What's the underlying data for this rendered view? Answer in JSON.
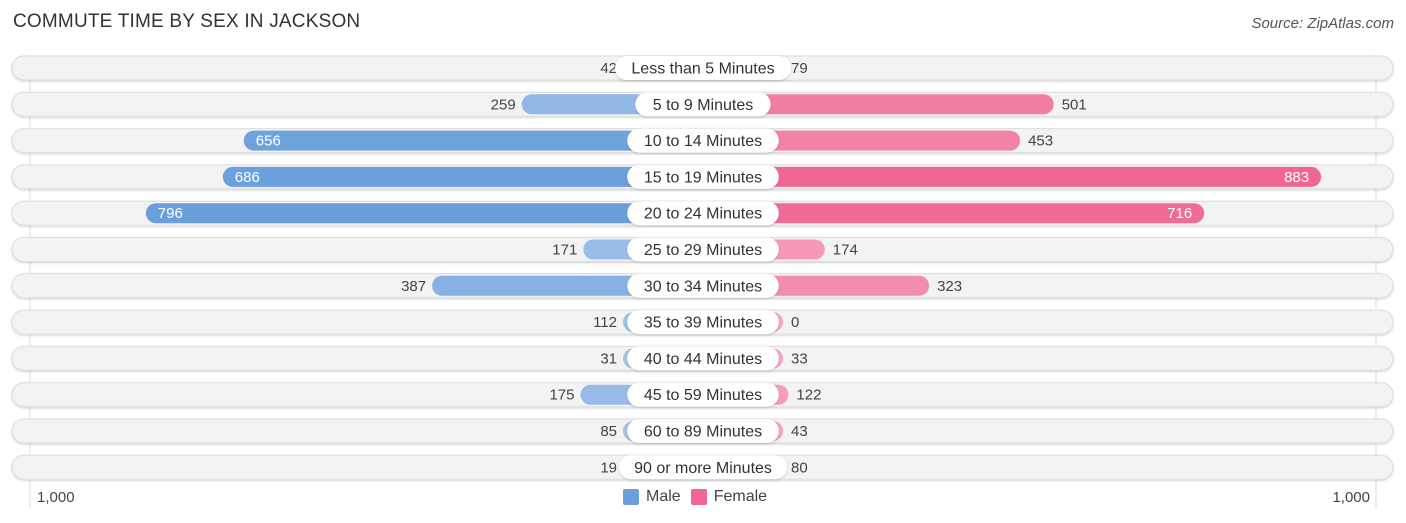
{
  "header": {
    "title": "COMMUTE TIME BY SEX IN JACKSON",
    "source": "Source: ZipAtlas.com"
  },
  "chart_data": {
    "type": "bar",
    "orientation": "horizontal-diverging",
    "title": "Commute Time by Sex in Jackson",
    "categories": [
      "Less than 5 Minutes",
      "5 to 9 Minutes",
      "10 to 14 Minutes",
      "15 to 19 Minutes",
      "20 to 24 Minutes",
      "25 to 29 Minutes",
      "30 to 34 Minutes",
      "35 to 39 Minutes",
      "40 to 44 Minutes",
      "45 to 59 Minutes",
      "60 to 89 Minutes",
      "90 or more Minutes"
    ],
    "series": [
      {
        "name": "Male",
        "color": "#6a9fdc",
        "values": [
          42,
          259,
          656,
          686,
          796,
          171,
          387,
          112,
          31,
          175,
          85,
          19
        ]
      },
      {
        "name": "Female",
        "color": "#f06892",
        "values": [
          79,
          501,
          453,
          883,
          716,
          174,
          323,
          0,
          33,
          122,
          43,
          80
        ]
      }
    ],
    "xlim": [
      -1000,
      1000
    ],
    "axis_labels": {
      "left": "1,000",
      "right": "1,000"
    },
    "legend": {
      "position": "bottom-center",
      "items": [
        "Male",
        "Female"
      ]
    },
    "colors": {
      "male_light": "#a7c6ea",
      "male_dark": "#6a9fdc",
      "female_light": "#f7a8c0",
      "female_dark": "#f06892",
      "track": "#f3f3f3"
    }
  }
}
